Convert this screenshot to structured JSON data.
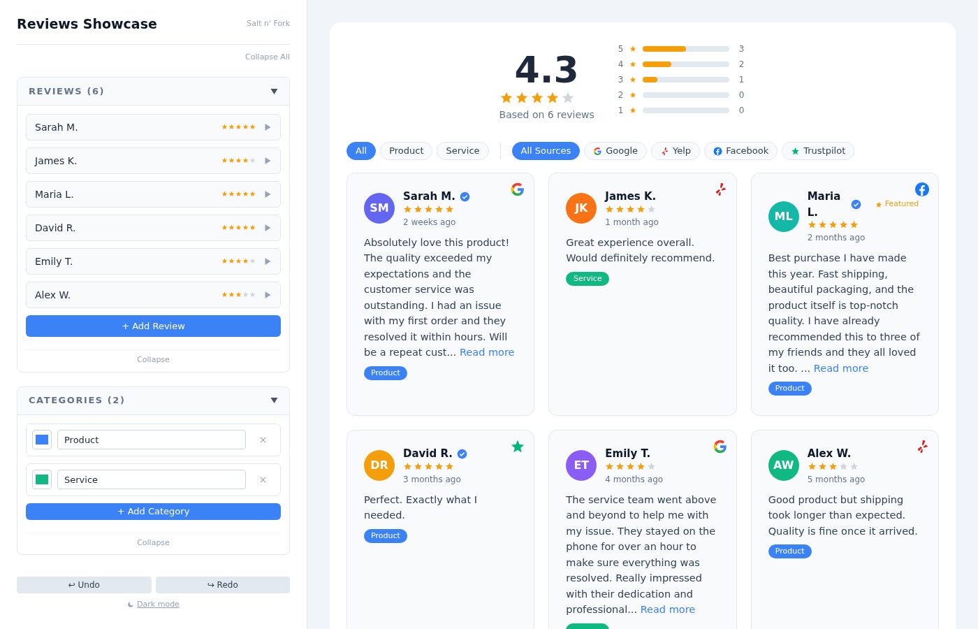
{
  "sidebar": {
    "title": "Reviews Showcase",
    "brand": "Salt n' Fork",
    "collapse_all": "Collapse All",
    "reviews_section": {
      "title": "REVIEWS (6)",
      "expanded": true,
      "add_button": "+ Add Review",
      "collapse": "Collapse",
      "items": [
        {
          "name": "Sarah M.",
          "stars": 5
        },
        {
          "name": "James K.",
          "stars": 4
        },
        {
          "name": "Maria L.",
          "stars": 5
        },
        {
          "name": "David R.",
          "stars": 5
        },
        {
          "name": "Emily T.",
          "stars": 4
        },
        {
          "name": "Alex W.",
          "stars": 3
        }
      ]
    },
    "categories_section": {
      "title": "CATEGORIES (2)",
      "expanded": true,
      "add_button": "+ Add Category",
      "collapse": "Collapse",
      "items": [
        {
          "value": "Product",
          "color": "#3b82f6"
        },
        {
          "value": "Service",
          "color": "#10b981"
        }
      ]
    },
    "undo": "↩ Undo",
    "redo": "↪ Redo",
    "dark_mode": "Dark mode"
  },
  "summary": {
    "average": "4.3",
    "stars": 4,
    "based_on": "Based on 6 reviews",
    "distribution": [
      {
        "label": "5",
        "level": 0.5,
        "count": "3"
      },
      {
        "label": "4",
        "level": 0.333,
        "count": "2"
      },
      {
        "label": "3",
        "level": 0.167,
        "count": "1"
      },
      {
        "label": "2",
        "level": 0,
        "count": "0"
      },
      {
        "label": "1",
        "level": 0,
        "count": "0"
      }
    ]
  },
  "filters": {
    "categories": [
      {
        "label": "All",
        "selected": true
      },
      {
        "label": "Product",
        "selected": false
      },
      {
        "label": "Service",
        "selected": false
      }
    ],
    "sources": [
      {
        "label": "All Sources",
        "selected": true,
        "kind": "all"
      },
      {
        "label": "Google",
        "selected": false,
        "kind": "google"
      },
      {
        "label": "Yelp",
        "selected": false,
        "kind": "yelp"
      },
      {
        "label": "Facebook",
        "selected": false,
        "kind": "facebook"
      },
      {
        "label": "Trustpilot",
        "selected": false,
        "kind": "trustpilot"
      }
    ]
  },
  "reviews": [
    {
      "avatar": {
        "initials": "SM",
        "color": "#6366f1"
      },
      "name": "Sarah M.",
      "verified": true,
      "stars": 5,
      "time": "2 weeks ago",
      "kind": "google",
      "text": "Absolutely love this product! The quality exceeded my expectations and the customer service was outstanding. I had an issue with my first order and they resolved it within hours. Will be a repeat cust...",
      "read_more": "Read more",
      "tag": {
        "label": "Product",
        "color": "#3b82f6"
      }
    },
    {
      "avatar": {
        "initials": "JK",
        "color": "#f97316"
      },
      "name": "James K.",
      "verified": false,
      "stars": 4,
      "time": "1 month ago",
      "kind": "yelp",
      "text": "Great experience overall. Would definitely recommend.",
      "tag": {
        "label": "Service",
        "color": "#10b981"
      }
    },
    {
      "avatar": {
        "initials": "ML",
        "color": "#14b8a6"
      },
      "name": "Maria L.",
      "verified": true,
      "featured": "Featured",
      "stars": 5,
      "time": "2 months ago",
      "kind": "facebook",
      "text": "Best purchase I have made this year. Fast shipping, beautiful packaging, and the product itself is top-notch quality. I have already recommended this to three of my friends and they all loved it too. ...",
      "read_more": "Read more",
      "tag": {
        "label": "Product",
        "color": "#3b82f6"
      }
    },
    {
      "avatar": {
        "initials": "DR",
        "color": "#f59e0b"
      },
      "name": "David R.",
      "verified": true,
      "stars": 5,
      "time": "3 months ago",
      "kind": "trustpilot",
      "text": "Perfect. Exactly what I needed.",
      "tag": {
        "label": "Product",
        "color": "#3b82f6"
      }
    },
    {
      "avatar": {
        "initials": "ET",
        "color": "#8b5cf6"
      },
      "name": "Emily T.",
      "verified": false,
      "stars": 4,
      "time": "4 months ago",
      "kind": "google",
      "text": "The service team went above and beyond to help me with my issue. They stayed on the phone for over an hour to make sure everything was resolved. Really impressed with their dedication and professional...",
      "read_more": "Read more",
      "tag": {
        "color": "#10b981"
      }
    },
    {
      "avatar": {
        "initials": "AW",
        "color": "#10b981"
      },
      "name": "Alex W.",
      "verified": false,
      "stars": 3,
      "time": "5 months ago",
      "kind": "yelp",
      "text": "Good product but shipping took longer than expected. Quality is fine once it arrived.",
      "tag": {
        "label": "Product",
        "color": "#3b82f6"
      }
    }
  ]
}
